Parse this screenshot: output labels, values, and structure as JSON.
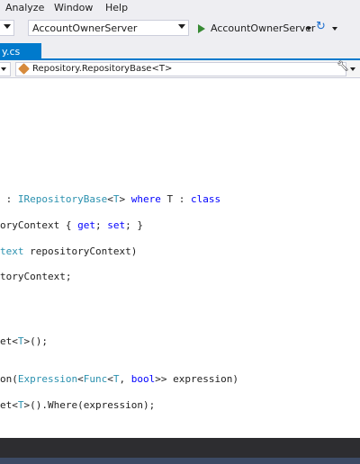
{
  "menu": {
    "items": [
      "Analyze",
      "Window",
      "Help"
    ]
  },
  "toolbar": {
    "project_combo": "AccountOwnerServer",
    "run_target": "AccountOwnerServer"
  },
  "tabs": [
    {
      "label": "y.cs",
      "active": true
    }
  ],
  "navbar": {
    "member": "Repository.RepositoryBase<T>"
  },
  "code": {
    "line1": {
      "p1": " : ",
      "t1": "IRepositoryBase",
      "p2": "<",
      "t2": "T",
      "p3": "> ",
      "k1": "where",
      "p4": " T : ",
      "k2": "class"
    },
    "line2": {
      "p1": "oryContext { ",
      "k1": "get",
      "p2": "; ",
      "k2": "set",
      "p3": "; }"
    },
    "line3": {
      "t1": "text",
      "p1": " repositoryContext)"
    },
    "line4": {
      "p1": "toryContext;"
    },
    "line5": {
      "p1": "et<",
      "t1": "T",
      "p2": ">();"
    },
    "line6": {
      "p1": "on(",
      "t1": "Expression",
      "p2": "<",
      "t2": "Func",
      "p3": "<",
      "t3": "T",
      "p4": ", ",
      "k1": "bool",
      "p5": ">> expression)"
    },
    "line7": {
      "p1": "et<",
      "t1": "T",
      "p2": ">().Where(expression);"
    }
  },
  "colors": {
    "accent": "#007acc",
    "keyword": "#0000ff",
    "type": "#2b91af",
    "chrome": "#eeeef2",
    "bottom": "#2d2d30"
  }
}
